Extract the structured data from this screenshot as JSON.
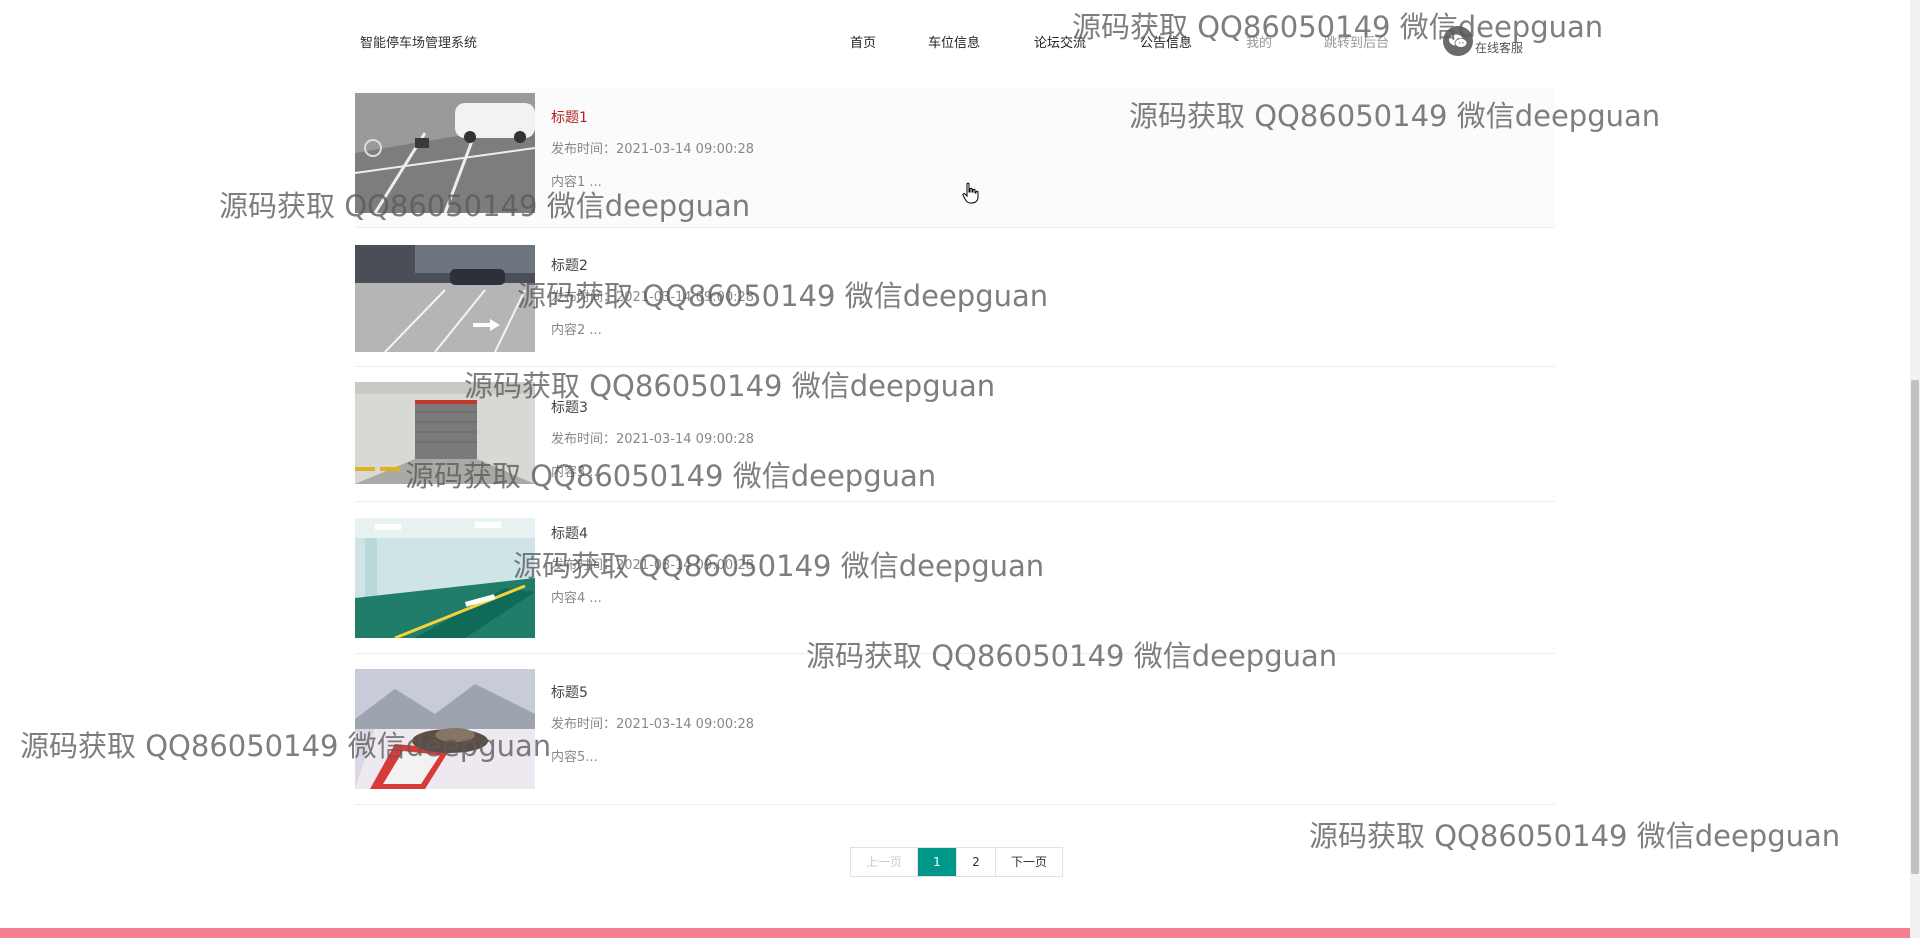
{
  "header": {
    "brand": "智能停车场管理系统",
    "nav": [
      "首页",
      "车位信息",
      "论坛交流",
      "公告信息",
      "我的",
      "跳转到后台"
    ],
    "service_label": "在线客服"
  },
  "articles": [
    {
      "title": "标题1",
      "time": "发布时间：2021-03-14 09:00:28",
      "snippet": "内容1 ..."
    },
    {
      "title": "标题2",
      "time": "发布时间：2021-03-14 09:00:28",
      "snippet": "内容2 ..."
    },
    {
      "title": "标题3",
      "time": "发布时间：2021-03-14 09:00:28",
      "snippet": "内容3 ..."
    },
    {
      "title": "标题4",
      "time": "发布时间：2021-03-14 09:00:28",
      "snippet": "内容4 ..."
    },
    {
      "title": "标题5",
      "time": "发布时间：2021-03-14 09:00:28",
      "snippet": "内容5..."
    }
  ],
  "pagination": {
    "prev": "上一页",
    "pages": [
      "1",
      "2"
    ],
    "current": "1",
    "next": "下一页"
  },
  "watermark": "源码获取 QQ86050149 微信deepguan",
  "colors": {
    "accent": "#009688",
    "active_title": "#b22222",
    "footer": "#f37f8f"
  }
}
